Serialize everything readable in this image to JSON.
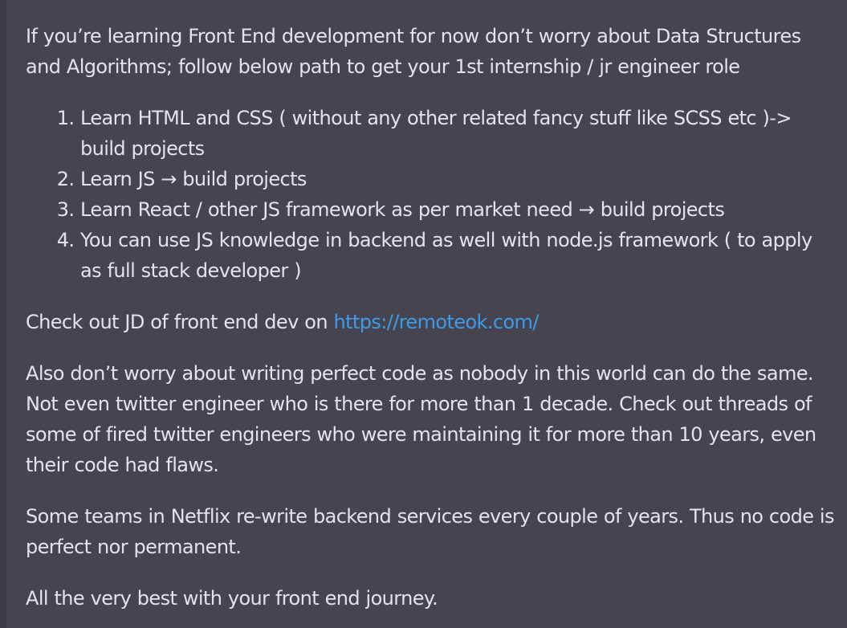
{
  "post": {
    "intro": "If you’re learning Front End development for now don’t worry about Data Structures and Algorithms; follow below path to get your 1st internship / jr engineer role",
    "steps": [
      "Learn HTML and CSS ( without any other related fancy stuff like SCSS etc )-> build projects",
      "Learn JS → build projects",
      "Learn React / other JS framework as per market need → build projects",
      "You can use JS knowledge in backend as well with node.js framework ( to apply as full stack developer )"
    ],
    "jd_prefix": "Check out JD of front end dev on ",
    "jd_link": "https://remoteok.com/",
    "para_code": "Also don’t worry about writing perfect code as nobody in this world can do the same. Not even twitter engineer who is there for more than 1 decade. Check out threads of some of fired twitter engineers who were maintaining it for more than 10 years, even their code had flaws.",
    "para_netflix": "Some teams in Netflix re-write backend services every couple of years. Thus no code is perfect nor permanent.",
    "closing": "All the very best with your front end journey."
  },
  "colors": {
    "background": "#46454f",
    "text": "#e4e3ea",
    "link": "#3d9be9"
  }
}
